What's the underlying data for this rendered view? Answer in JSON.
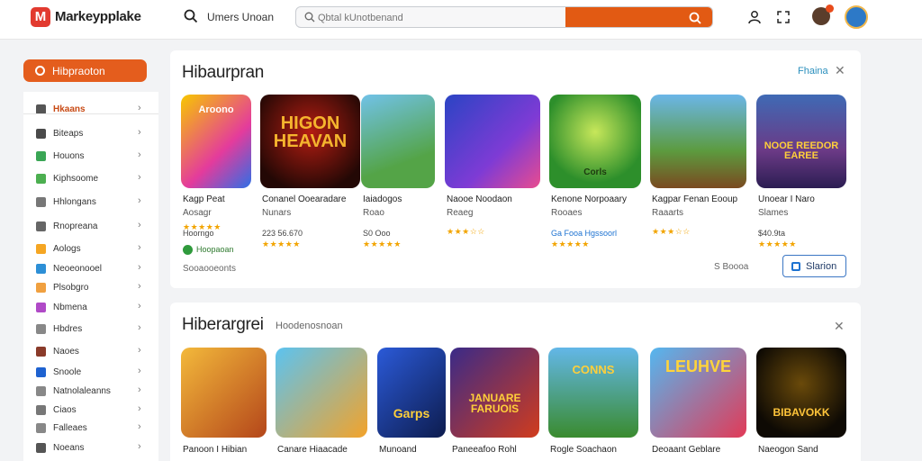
{
  "header": {
    "logo_letter": "M",
    "logo_text": "Markeypplake",
    "nav_label": "Umers Unoan",
    "search_placeholder": "Qbtal kUnotbenand",
    "accent": "#e25a13"
  },
  "sidebar": {
    "cta_label": "Hibpraoton",
    "items": [
      {
        "label": "Hkaans",
        "icon": "grid-icon",
        "active": true
      },
      {
        "label": "Biteaps",
        "icon": "apps-icon"
      },
      {
        "label": "Houons",
        "icon": "category-icon"
      },
      {
        "label": "Kiphsoome",
        "icon": "category-icon"
      },
      {
        "label": "Hhlongans",
        "icon": "category-icon"
      },
      {
        "label": "Rnopreana",
        "icon": "category-icon"
      },
      {
        "label": "Aologs",
        "icon": "category-icon"
      },
      {
        "label": "Neoeonooel",
        "icon": "category-icon"
      },
      {
        "label": "Plsobgro",
        "icon": "category-icon"
      },
      {
        "label": "Nbmena",
        "icon": "category-icon"
      },
      {
        "label": "Hbdres",
        "icon": "category-icon"
      },
      {
        "label": "Naoes",
        "icon": "category-icon"
      },
      {
        "label": "Snoole",
        "icon": "category-icon"
      },
      {
        "label": "Natnolaleanns",
        "icon": "category-icon"
      },
      {
        "label": "Ciaos",
        "icon": "category-icon"
      },
      {
        "label": "Falleaes",
        "icon": "category-icon"
      },
      {
        "label": "Noeans",
        "icon": "category-icon"
      }
    ]
  },
  "section1": {
    "title": "Hibaurpran",
    "link": "Fhaina",
    "cards": [
      {
        "art": "Aroono",
        "name": "Kagp Peat",
        "sub": "Aosagr",
        "price": "Hoorngo",
        "stars": "★★★★★",
        "badge": "Hoopaoan"
      },
      {
        "art": "HIGON HEAVAN",
        "name": "Conanel Ooearadare",
        "sub": "Nunars",
        "price": "223 56.670",
        "stars": "★★★★★"
      },
      {
        "art": "",
        "name": "Iaiadogos",
        "sub": "Roao",
        "price": "S0 Ooo",
        "stars": "★★★★★"
      },
      {
        "art": "",
        "name": "Naooe Noodaon",
        "sub": "Reaeg",
        "price": "",
        "stars": "★★★☆☆"
      },
      {
        "art": "Corls",
        "name": "Kenone Norpoaary",
        "sub": "Rooaes",
        "price": "Ga Fooa Hgssoorl",
        "stars": "★★★★★"
      },
      {
        "art": "",
        "name": "Kagpar Fenan Eooup",
        "sub": "Raaarts",
        "price": "",
        "stars": "★★★☆☆"
      },
      {
        "art": "NOOE REEDOR EAREE",
        "name": "Unoear I Naro",
        "sub": "Slames",
        "price": "$40.9ta",
        "stars": "★★★★★"
      }
    ],
    "footer_left": "Sooaooeonts",
    "footer_right": "S  Boooa",
    "view_button": "Slarion"
  },
  "section2": {
    "title": "Hiberargrei",
    "subtitle": "Hoodenosnoan",
    "cards": [
      {
        "name": "Panoon I Hibian"
      },
      {
        "name": "Canare Hiaacade"
      },
      {
        "art": "Garps",
        "name": "Munoand"
      },
      {
        "art": "JANUARE FARUOIS",
        "name": "Paneeafoo Rohl"
      },
      {
        "art": "CONNS",
        "name": "Rogle Soachaon"
      },
      {
        "art": "LEUHVE",
        "name": "Deoaant Geblare"
      },
      {
        "art": "BIBAVOKK",
        "name": "Naeogon Sand"
      }
    ]
  }
}
